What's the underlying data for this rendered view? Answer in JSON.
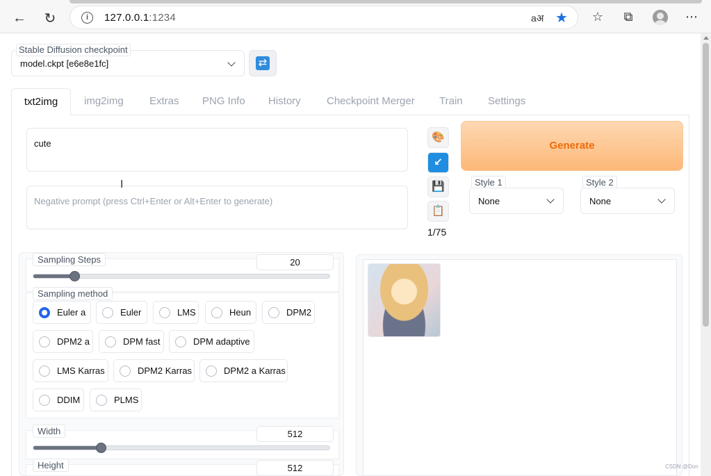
{
  "browser": {
    "url_host": "127.0.0.1",
    "url_port": ":1234",
    "read_aloud_icon": "aअ",
    "info_icon": "i"
  },
  "checkpoint": {
    "label": "Stable Diffusion checkpoint",
    "value": "model.ckpt [e6e8e1fc]"
  },
  "tabs": [
    "txt2img",
    "img2img",
    "Extras",
    "PNG Info",
    "History",
    "Checkpoint Merger",
    "Train",
    "Settings"
  ],
  "prompt": {
    "positive": "cute",
    "negative_placeholder": "Negative prompt (press Ctrl+Enter or Alt+Enter to generate)"
  },
  "side_buttons": [
    "palette-icon",
    "arrow-icon",
    "save-icon",
    "clipboard-icon"
  ],
  "token_counter": "1/75",
  "generate_label": "Generate",
  "styles": [
    {
      "label": "Style 1",
      "value": "None"
    },
    {
      "label": "Style 2",
      "value": "None"
    }
  ],
  "sampling_steps": {
    "label": "Sampling Steps",
    "value": "20",
    "fraction": 0.14
  },
  "sampling_method": {
    "label": "Sampling method",
    "options": [
      "Euler a",
      "Euler",
      "LMS",
      "Heun",
      "DPM2",
      "DPM2 a",
      "DPM fast",
      "DPM adaptive",
      "LMS Karras",
      "DPM2 Karras",
      "DPM2 a Karras",
      "DDIM",
      "PLMS"
    ],
    "selected": "Euler a"
  },
  "width": {
    "label": "Width",
    "value": "512",
    "fraction": 0.23
  },
  "height": {
    "label": "Height",
    "value": "512"
  },
  "watermark": "CSDN @Don"
}
